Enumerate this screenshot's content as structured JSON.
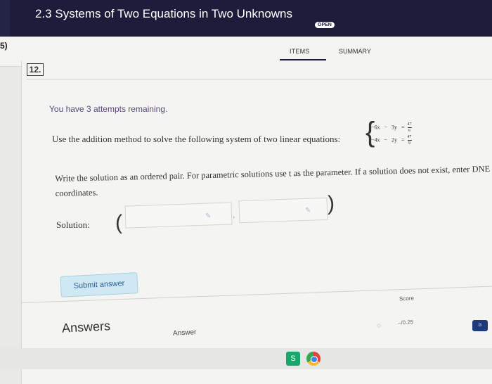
{
  "header": {
    "title": "2.3 Systems of Two Equations in Two Unknowns",
    "badge": "OPEN",
    "left_fragment": "5)"
  },
  "tabs": {
    "items": "ITEMS",
    "summary": "SUMMARY",
    "active": "items"
  },
  "question": {
    "number": "12.",
    "attempts": "You have 3 attempts remaining.",
    "prompt": "Use the addition method to solve the following system of two linear equations:",
    "system": {
      "eq1": {
        "a": "−6x",
        "op": "−",
        "b": "3y",
        "eq": "=",
        "num": "47",
        "den": "6"
      },
      "eq2": {
        "a": "−4x",
        "op": "−",
        "b": "2y",
        "eq": "=",
        "num": "47",
        "den": "9"
      }
    },
    "instruction_line1": "Write the solution as an ordered pair. For parametric solutions use t as the parameter. If a solution does not exist, enter DNE",
    "instruction_line2": "coordinates.",
    "solution_label": "Solution:",
    "open_paren": "(",
    "close_paren": ")",
    "comma": ",",
    "coord_x_value": "",
    "coord_y_value": "",
    "submit_label": "Submit answer"
  },
  "answers": {
    "title": "Answers",
    "answer_column": "Answer",
    "score_label": "Score",
    "score_value": "–/0.25"
  },
  "colors": {
    "header_bg": "#1d1d3b",
    "submit_bg": "#cfe8f3",
    "attempts_text": "#5a4a78"
  },
  "dock": {
    "app1_label": "S",
    "corner_label": "G"
  }
}
